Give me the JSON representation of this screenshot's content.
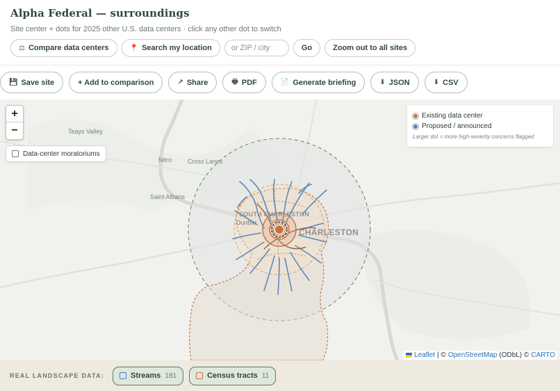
{
  "header": {
    "title": "Alpha Federal — surroundings",
    "subtitle": "Site center + dots for 2025 other U.S. data centers · click any other dot to switch",
    "compare_label": "Compare data centers",
    "search_location_label": "Search my location",
    "zip_placeholder": "or ZIP / city",
    "go_label": "Go",
    "zoom_out_label": "Zoom out to all sites"
  },
  "toolbar": {
    "save_label": "Save site",
    "add_comparison_label": "+ Add to comparison",
    "share_label": "Share",
    "pdf_label": "PDF",
    "briefing_label": "Generate briefing",
    "json_label": "JSON",
    "csv_label": "CSV"
  },
  "map": {
    "zoom_in": "+",
    "zoom_out": "−",
    "moratoriums_label": "Data-center moratoriums",
    "places": {
      "teays_valley": "Teays Valley",
      "nitro": "Nitro",
      "cross_lanes": "Cross Lanes",
      "saint_albans": "Saint Albans",
      "south_charleston": "SOUTH CHARLESTON",
      "dunbar": "Dunbar",
      "charleston": "CHARLESTON"
    },
    "legend": {
      "existing_label": "Existing data center",
      "proposed_label": "Proposed / announced",
      "note": "Larger dot = more high-severity concerns flagged",
      "existing_color": "#c8733f",
      "proposed_color": "#4f7fc4"
    },
    "attribution": {
      "leaflet": "Leaflet",
      "sep1": "| ©",
      "osm": "OpenStreetMap",
      "odbl": "(ODbL) ©",
      "carto": "CARTO"
    }
  },
  "footer": {
    "label": "REAL LANDSCAPE DATA:",
    "streams_label": "Streams",
    "streams_count": "181",
    "tracts_label": "Census tracts",
    "tracts_count": "11",
    "streams_color": "#4f7fc4",
    "tracts_color": "#c8733f"
  }
}
